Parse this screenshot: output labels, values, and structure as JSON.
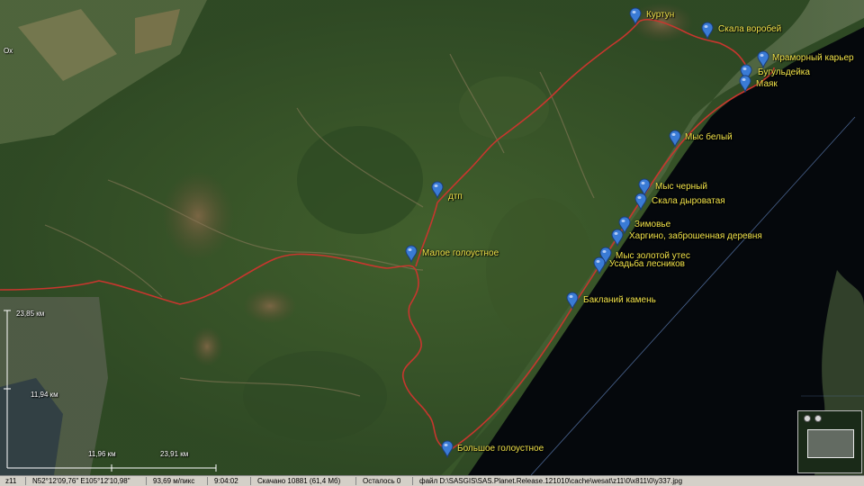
{
  "map": {
    "route_color": "#c8362e",
    "label_color": "#f0e24a",
    "pin_color": "#3a7bd5",
    "water_color": "#05080c"
  },
  "places": [
    {
      "id": "kurtun",
      "name": "Куртун"
    },
    {
      "id": "skala-vorobey",
      "name": "Скала воробей"
    },
    {
      "id": "mramorny-karer",
      "name": "Мраморный карьер"
    },
    {
      "id": "butulaeyka",
      "name": "Бугульдейка"
    },
    {
      "id": "mayak",
      "name": "Маяк"
    },
    {
      "id": "mys-bely",
      "name": "Мыс белый"
    },
    {
      "id": "dtp",
      "name": "дтп"
    },
    {
      "id": "mys-cherny",
      "name": "Мыс черный"
    },
    {
      "id": "skala-dyrovataya",
      "name": "Скала дыроватая"
    },
    {
      "id": "zimovye",
      "name": "Зимовье"
    },
    {
      "id": "khargino",
      "name": "Харгино, заброшенная деревня"
    },
    {
      "id": "maloe-golоustnoe",
      "name": "Малое голоустное"
    },
    {
      "id": "mys-zolotoy",
      "name": "Мыс золотой утес"
    },
    {
      "id": "usadba",
      "name": "Усадьба лесников"
    },
    {
      "id": "baklany",
      "name": "Бакланий камень"
    },
    {
      "id": "bolshoe",
      "name": "Большое голоустное"
    }
  ],
  "scale_labels": {
    "a": "23,85 км",
    "b": "11,94 км",
    "c": "11,96 км",
    "d": "23,91 км",
    "corner": "Ох"
  },
  "statusbar": {
    "zoom": "z11",
    "coords": "N52°12'09,76\" E105°12'10,98\"",
    "resolution": "93,69 м/пикс",
    "time": "9:04:02",
    "downloaded": "Скачано 10881 (61,4 Мб)",
    "remaining": "Осталось 0",
    "file": "файл D:\\SASGIS\\SAS.Planet.Release.121010\\cache\\wesat\\z11\\0\\x811\\0\\y337.jpg"
  }
}
